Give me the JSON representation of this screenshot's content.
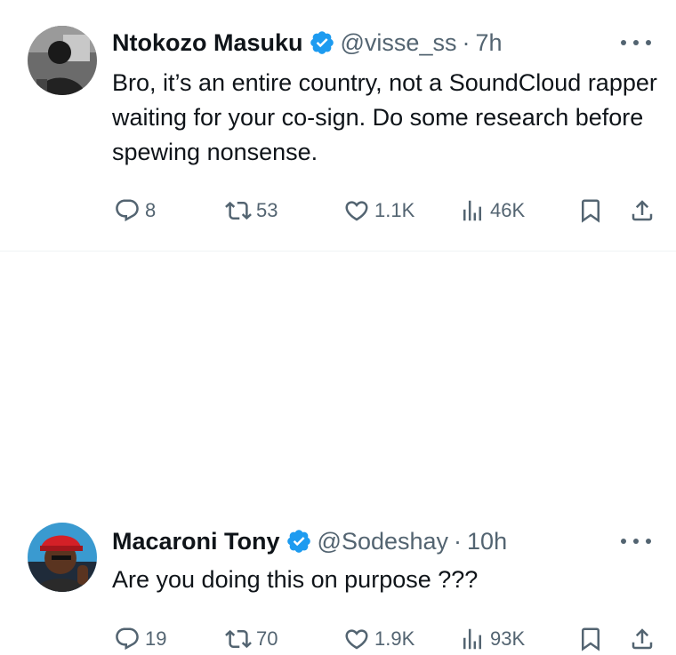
{
  "tweets": [
    {
      "name": "Ntokozo Masuku",
      "handle": "@visse_ss",
      "separator": "·",
      "time": "7h",
      "text": "Bro, it’s an entire country, not a SoundCloud rapper waiting for your co-sign. Do some research before spewing nonsense.",
      "replies": "8",
      "retweets": "53",
      "likes": "1.1K",
      "views": "46K"
    },
    {
      "name": "Macaroni Tony",
      "handle": "@Sodeshay",
      "separator": "·",
      "time": "10h",
      "text": "Are you doing this on purpose ???",
      "replies": "19",
      "retweets": "70",
      "likes": "1.9K",
      "views": "93K"
    }
  ],
  "colors": {
    "verified": "#1d9bf0",
    "text": "#0f1419",
    "secondary": "#536471",
    "divider": "#eff3f4"
  },
  "icons": [
    "verified-badge-icon",
    "more-icon",
    "reply-icon",
    "retweet-icon",
    "like-icon",
    "views-icon",
    "bookmark-icon",
    "share-icon"
  ]
}
